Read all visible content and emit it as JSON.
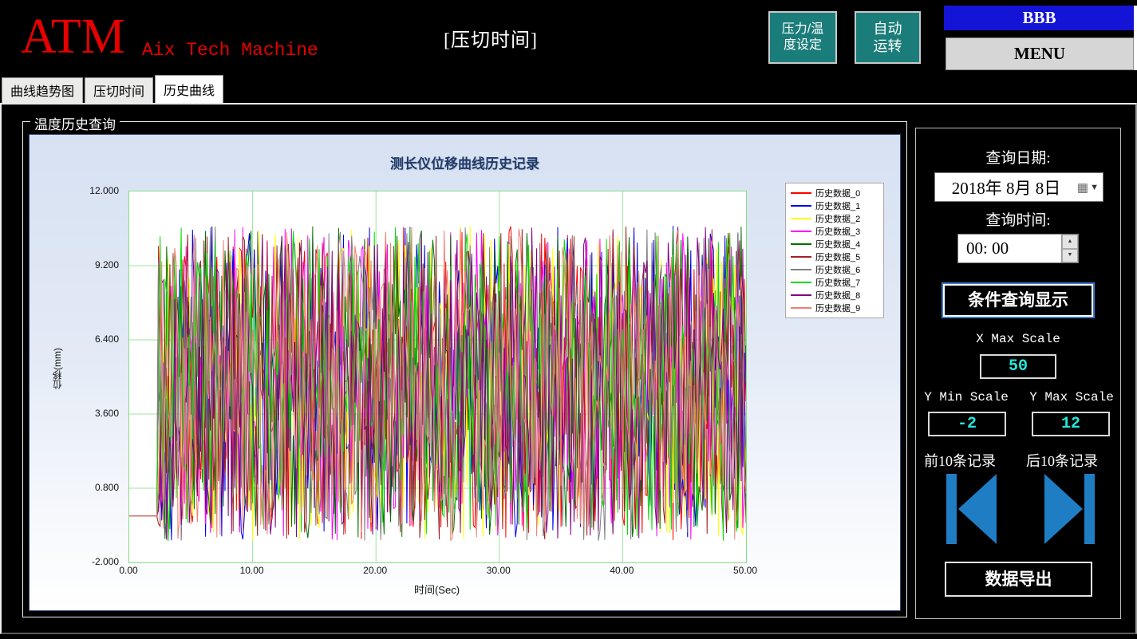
{
  "header": {
    "logo": "ATM",
    "logo_subtitle": "Aix Tech Machine",
    "page_title": "[压切时间]",
    "pressure_temp_button_line1": "压力/温",
    "pressure_temp_button_line2": "度设定",
    "auto_run_button_line1": "自动",
    "auto_run_button_line2": "运转",
    "bbb_label": "BBB",
    "menu_label": "MENU",
    "teal_color": "#1a7d7a",
    "bbb_blue_color": "#1414d6",
    "logo_red_color": "#e60000"
  },
  "tabs": [
    {
      "label": "曲线趋势图",
      "active": false
    },
    {
      "label": "压切时间",
      "active": false
    },
    {
      "label": "历史曲线",
      "active": true
    }
  ],
  "groupbox_title": "温度历史查询",
  "chart_data": {
    "type": "line",
    "title": "测长仪位移曲线历史记录",
    "xlabel": "时间(Sec)",
    "ylabel": "位移(mm)",
    "xlim": [
      0,
      50
    ],
    "ylim": [
      -2,
      12
    ],
    "x_ticks": [
      "0.00",
      "10.00",
      "20.00",
      "30.00",
      "40.00",
      "50.00"
    ],
    "y_ticks": [
      "12.000",
      "9.200",
      "6.400",
      "3.600",
      "0.800",
      "-2.000"
    ],
    "grid": true,
    "grid_color": "#9de49d",
    "plot_bg": "#ffffff",
    "legend_position": "right-top",
    "series": [
      {
        "name": "历史数据_0",
        "color": "#ff0000"
      },
      {
        "name": "历史数据_1",
        "color": "#0000ee"
      },
      {
        "name": "历史数据_2",
        "color": "#ffff00"
      },
      {
        "name": "历史数据_3",
        "color": "#ff00ff"
      },
      {
        "name": "历史数据_4",
        "color": "#007000"
      },
      {
        "name": "历史数据_5",
        "color": "#a02020"
      },
      {
        "name": "历史数据_6",
        "color": "#808080"
      },
      {
        "name": "历史数据_7",
        "color": "#00dd00"
      },
      {
        "name": "历史数据_8",
        "color": "#800080"
      },
      {
        "name": "历史数据_9",
        "color": "#f08070"
      }
    ],
    "pattern": {
      "description": "All 10 series lie flat at about -0.25 mm from t=0 to about t=2.3 s, then oscillate as dense random noise mostly between -0.2 and 9.9 mm with occasional spikes up to ~10.7 and dips to ~-1.2 until t=50 s.",
      "flat_until": 2.3,
      "flat_value": -0.25,
      "noise_base_min": -0.2,
      "noise_base_max": 9.9,
      "spike_max": 10.7,
      "dip_min": -1.2,
      "points_per_series": 380,
      "seed": 7
    }
  },
  "right_panel": {
    "query_date_label": "查询日期:",
    "query_date_value": "2018年 8月 8日",
    "query_time_label": "查询时间:",
    "query_time_value": "00: 00",
    "query_button_label": "条件查询显示",
    "x_max_scale_label": "X Max Scale",
    "x_max_scale_value": "50",
    "y_min_scale_label": "Y Min Scale",
    "y_min_scale_value": "-2",
    "y_max_scale_label": "Y Max Scale",
    "y_max_scale_value": "12",
    "prev_records_label": "前10条记录",
    "next_records_label": "后10条记录",
    "export_button_label": "数据导出",
    "value_cyan_color": "#22e8de",
    "arrow_blue_color": "#1f7dc4"
  }
}
